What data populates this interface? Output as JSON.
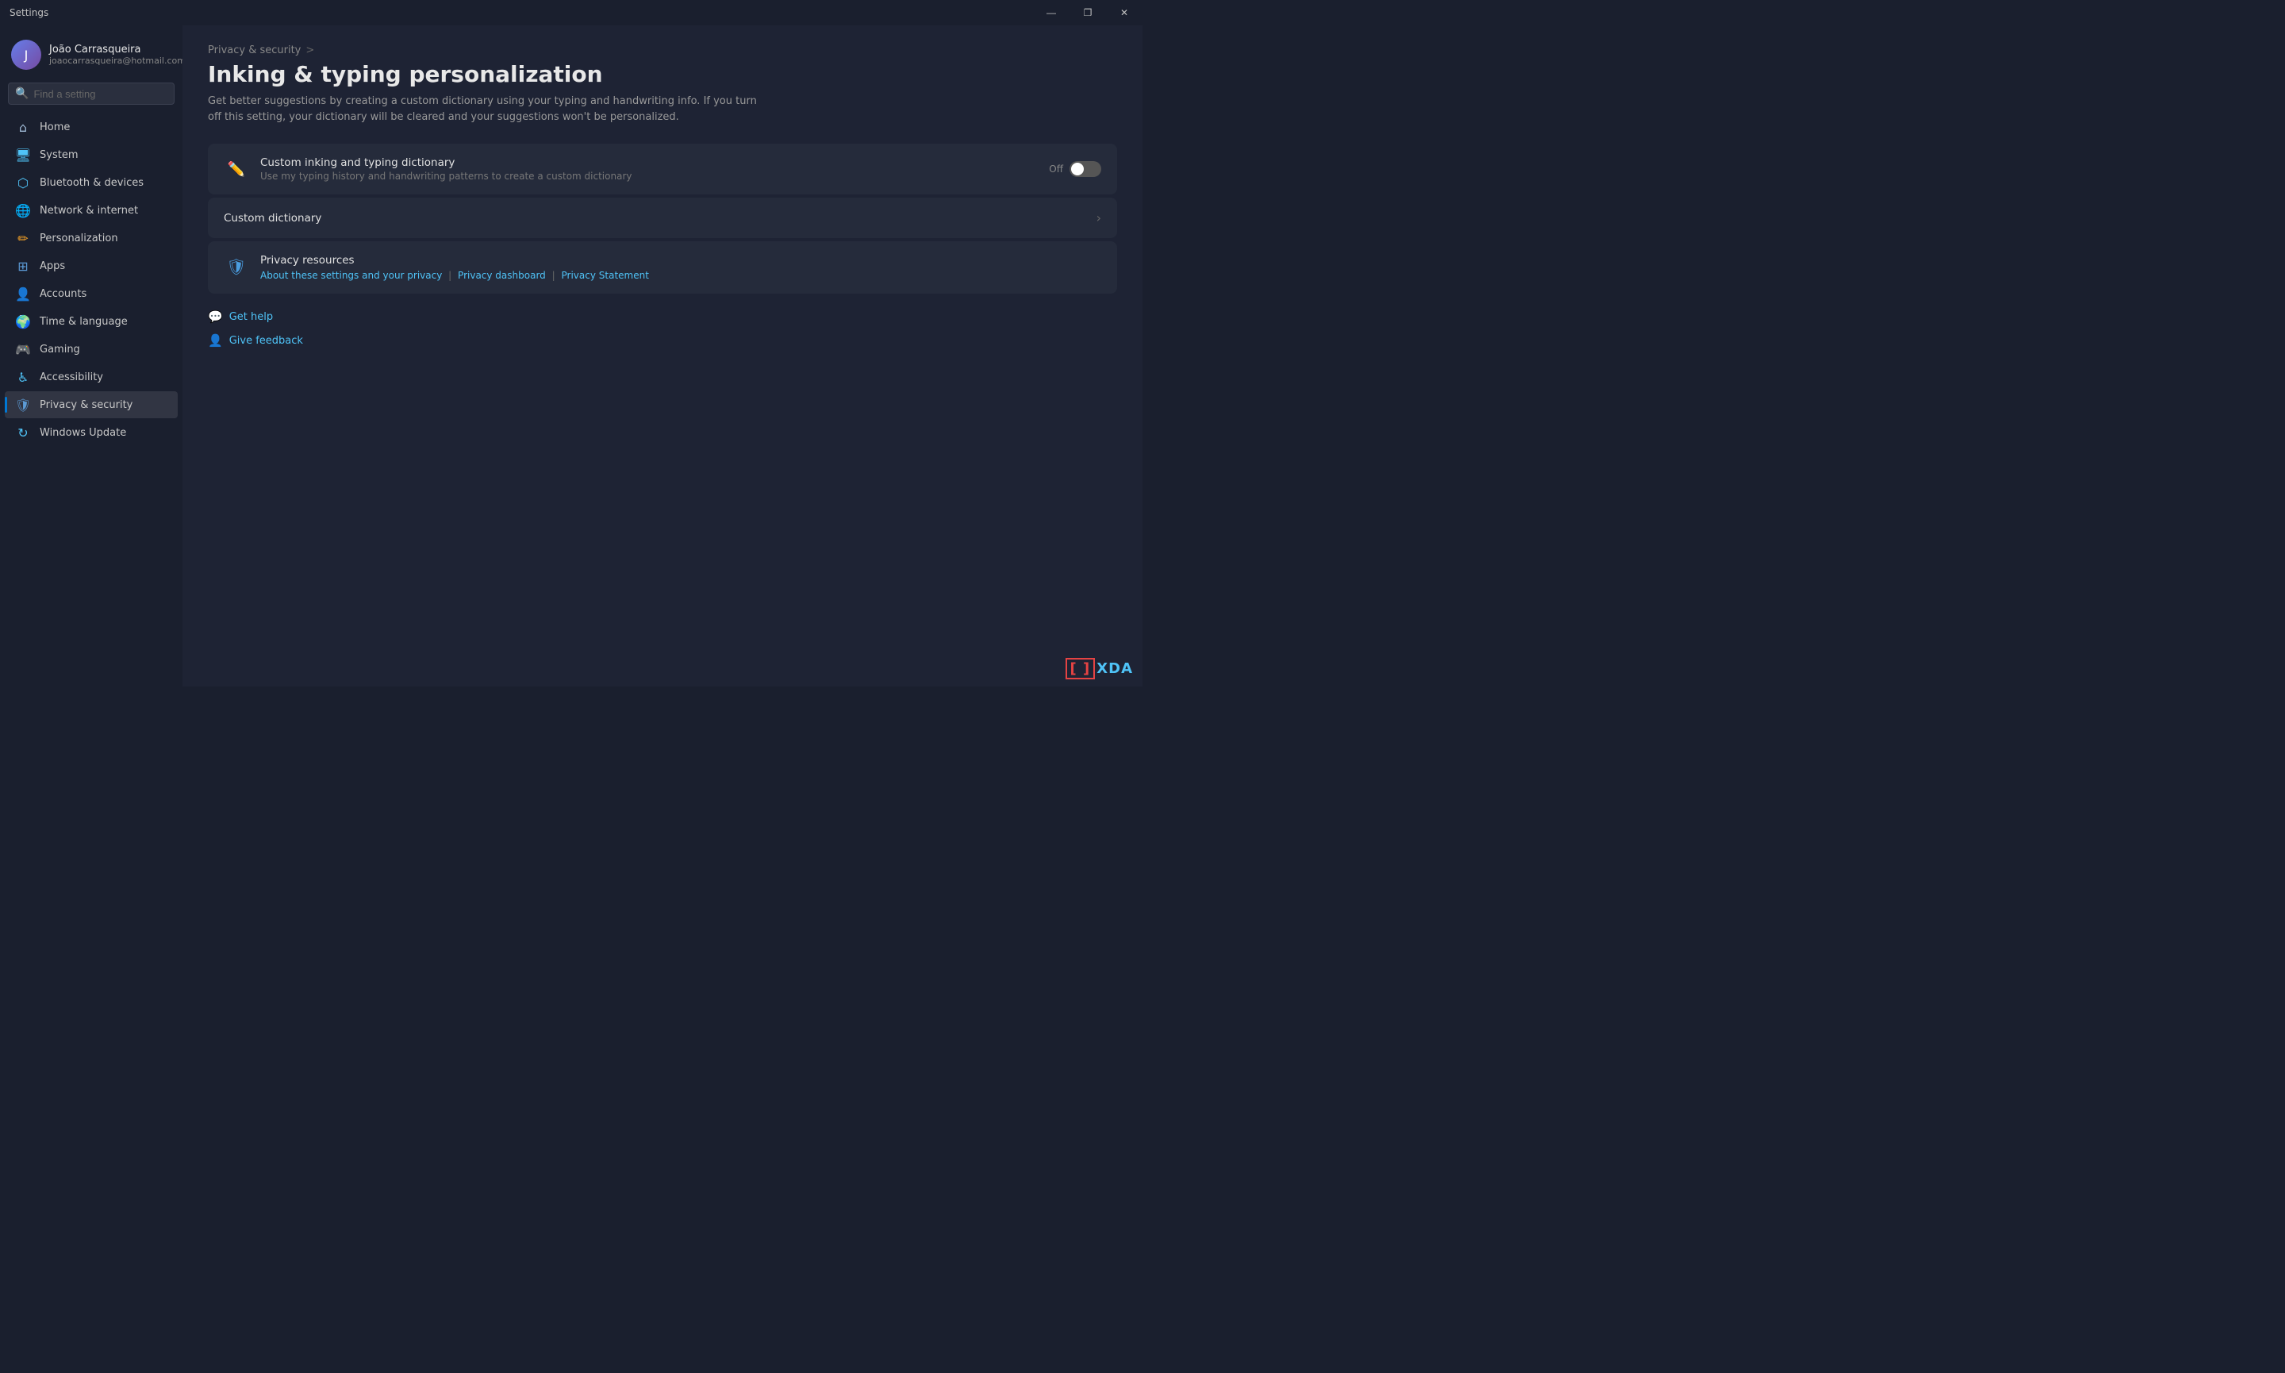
{
  "titlebar": {
    "title": "Settings",
    "min_label": "—",
    "restore_label": "❐",
    "close_label": "✕"
  },
  "sidebar": {
    "user": {
      "name": "João Carrasqueira",
      "email": "joaocarrasqueira@hotmail.com",
      "avatar_initial": "J"
    },
    "search": {
      "placeholder": "Find a setting"
    },
    "nav_items": [
      {
        "id": "home",
        "label": "Home",
        "icon": "⌂",
        "icon_class": "blue2",
        "active": false
      },
      {
        "id": "system",
        "label": "System",
        "icon": "💻",
        "icon_class": "blue",
        "active": false
      },
      {
        "id": "bluetooth",
        "label": "Bluetooth & devices",
        "icon": "⬡",
        "icon_class": "blue",
        "active": false
      },
      {
        "id": "network",
        "label": "Network & internet",
        "icon": "🌐",
        "icon_class": "cyan",
        "active": false
      },
      {
        "id": "personalization",
        "label": "Personalization",
        "icon": "✏",
        "icon_class": "orange",
        "active": false
      },
      {
        "id": "apps",
        "label": "Apps",
        "icon": "⊞",
        "icon_class": "blue",
        "active": false
      },
      {
        "id": "accounts",
        "label": "Accounts",
        "icon": "👤",
        "icon_class": "teal",
        "active": false
      },
      {
        "id": "time",
        "label": "Time & language",
        "icon": "🌍",
        "icon_class": "teal",
        "active": false
      },
      {
        "id": "gaming",
        "label": "Gaming",
        "icon": "🎮",
        "icon_class": "gray",
        "active": false
      },
      {
        "id": "accessibility",
        "label": "Accessibility",
        "icon": "♿",
        "icon_class": "blue",
        "active": false
      },
      {
        "id": "privacy",
        "label": "Privacy & security",
        "icon": "🛡",
        "icon_class": "blue2",
        "active": true
      },
      {
        "id": "windows_update",
        "label": "Windows Update",
        "icon": "↻",
        "icon_class": "blue",
        "active": false
      }
    ]
  },
  "main": {
    "breadcrumb_parent": "Privacy & security",
    "breadcrumb_sep": ">",
    "page_title": "Inking & typing personalization",
    "page_desc": "Get better suggestions by creating a custom dictionary using your typing and handwriting info. If you turn off this setting, your dictionary will be cleared and your suggestions won't be personalized.",
    "settings": [
      {
        "id": "custom_inking",
        "icon": "✏",
        "name": "Custom inking and typing dictionary",
        "desc": "Use my typing history and handwriting patterns to create a custom dictionary",
        "control_type": "toggle",
        "toggle_state": false,
        "toggle_label": "Off"
      }
    ],
    "custom_dictionary": {
      "name": "Custom dictionary",
      "has_chevron": true
    },
    "privacy_resources": {
      "title": "Privacy resources",
      "links": [
        {
          "label": "About these settings and your privacy",
          "id": "about-settings"
        },
        {
          "label": "Privacy dashboard",
          "id": "privacy-dashboard"
        },
        {
          "label": "Privacy Statement",
          "id": "privacy-statement"
        }
      ]
    },
    "help": {
      "get_help": "Get help",
      "give_feedback": "Give feedback"
    }
  },
  "xda": {
    "text": "[ ]XDA"
  }
}
